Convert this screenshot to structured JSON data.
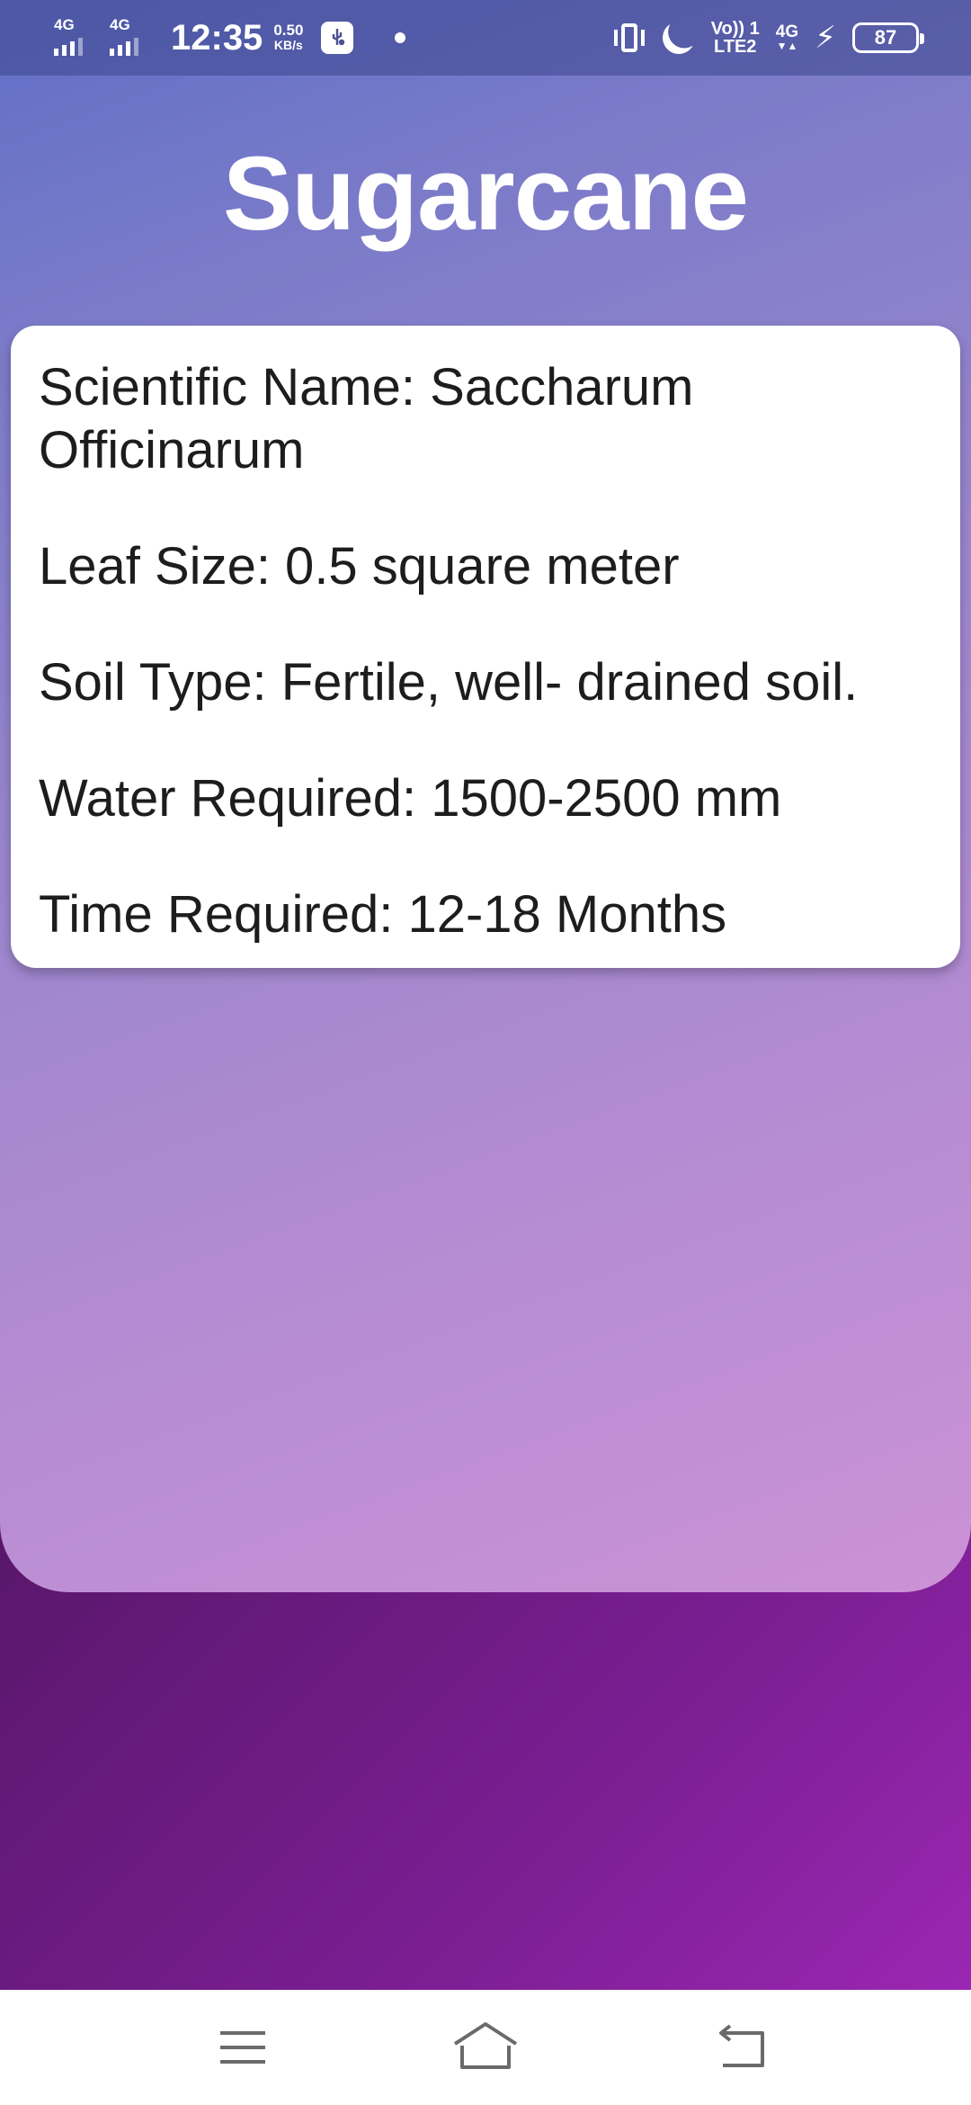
{
  "status_bar": {
    "sim1_network": "4G",
    "sim2_network": "4G",
    "time": "12:35",
    "speed_value": "0.50",
    "speed_unit": "KB/s",
    "volte_label": "Vo)) 1",
    "lte_label": "LTE2",
    "data_network": "4G",
    "battery_level": "87",
    "icons": [
      "signal-icon",
      "usb-debug-icon",
      "notification-dot-icon",
      "vibrate-icon",
      "do-not-disturb-icon",
      "charging-icon",
      "battery-icon"
    ]
  },
  "page": {
    "title": "Sugarcane"
  },
  "crop_info": {
    "scientific_name": "Scientific Name: Saccharum Officinarum",
    "leaf_size": "Leaf Size: 0.5 square meter",
    "soil_type": "Soil Type: Fertile, well- drained soil.",
    "water_required": "Water Required: 1500-2500 mm",
    "time_required": "Time Required: 12-18 Months"
  },
  "nav_bar": {
    "icons": [
      "menu-icon",
      "home-icon",
      "back-icon"
    ]
  },
  "colors": {
    "title_text": "#ffffff",
    "card_background": "#ffffff",
    "card_text": "#1d1d1d",
    "gradient_top": "#5f6fc6",
    "gradient_bottom": "#cc92d6",
    "lower_background": "#4a145a"
  }
}
